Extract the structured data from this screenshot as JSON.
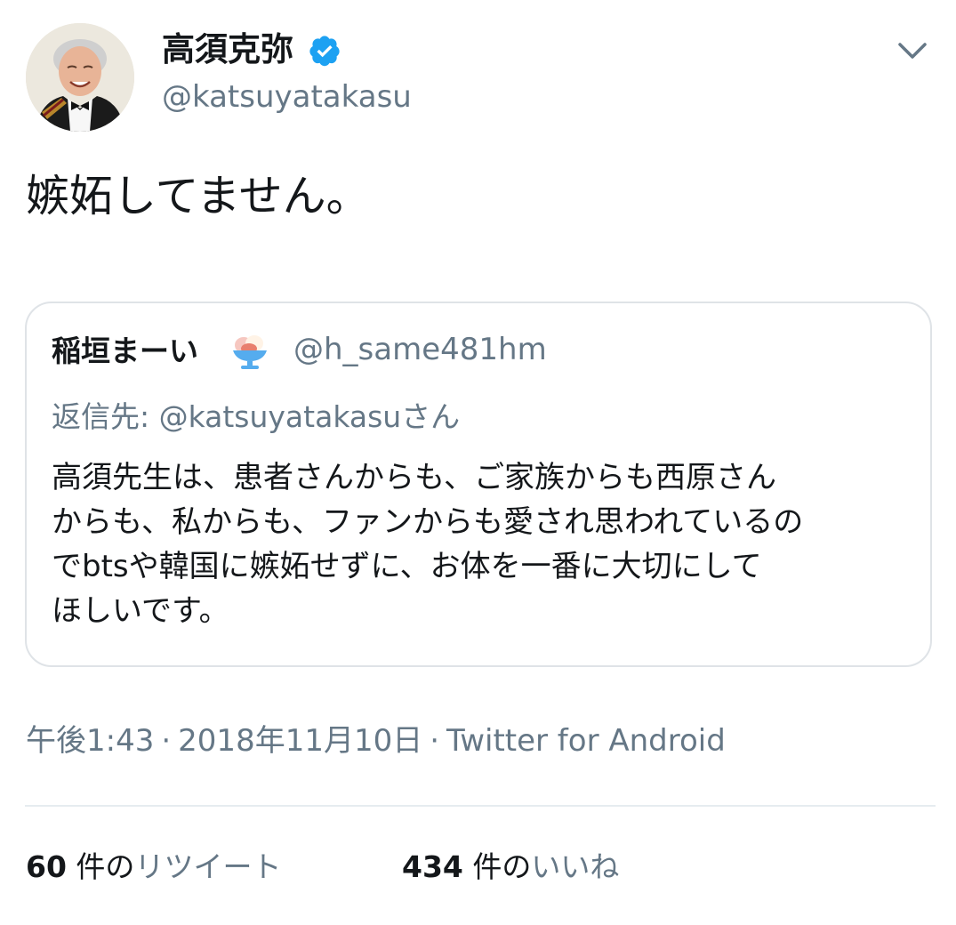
{
  "author": {
    "display_name": "高須克弥",
    "handle": "@katsuyatakasu",
    "verified": true,
    "avatar_icon": "profile-photo-icon"
  },
  "menu": {
    "icon": "chevron-down-icon"
  },
  "tweet": {
    "text": "嫉妬してません。"
  },
  "quoted": {
    "display_name": "稲垣まーい",
    "emoji_icon": "shaved-ice-icon",
    "handle": "@h_same481hm",
    "reply_to": "返信先: @katsuyatakasuさん",
    "lines": [
      "高須先生は、患者さんからも、ご家族からも西原さん",
      "からも、私からも、ファンからも愛され思われているの",
      "でbtsや韓国に嫉妬せずに、お体を一番に大切にして",
      "ほしいです。"
    ]
  },
  "meta": {
    "time": "午後1:43",
    "date": "2018年11月10日",
    "source": "Twitter for Android",
    "separator": "·"
  },
  "stats": {
    "retweets_count": "60",
    "retweets_unit": " 件の",
    "retweets_label": "リツイート",
    "likes_count": "434",
    "likes_unit": " 件の",
    "likes_label": "いいね"
  },
  "colors": {
    "text": "#14171a",
    "secondary": "#657786",
    "verified_blue": "#1da1f2",
    "border": "#dfe3e7"
  }
}
